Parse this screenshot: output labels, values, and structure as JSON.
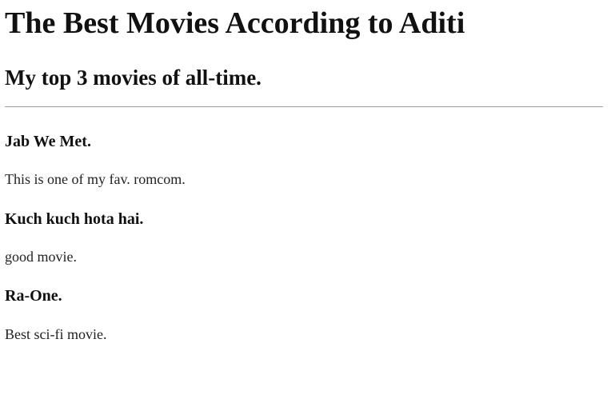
{
  "page": {
    "title": "The Best Movies According to Aditi",
    "subtitle": "My top 3 movies of all-time."
  },
  "movies": [
    {
      "title": "Jab We Met.",
      "description": "This is one of my fav. romcom."
    },
    {
      "title": "Kuch kuch hota hai.",
      "description": "good movie."
    },
    {
      "title": "Ra-One.",
      "description": "Best sci-fi movie."
    }
  ]
}
